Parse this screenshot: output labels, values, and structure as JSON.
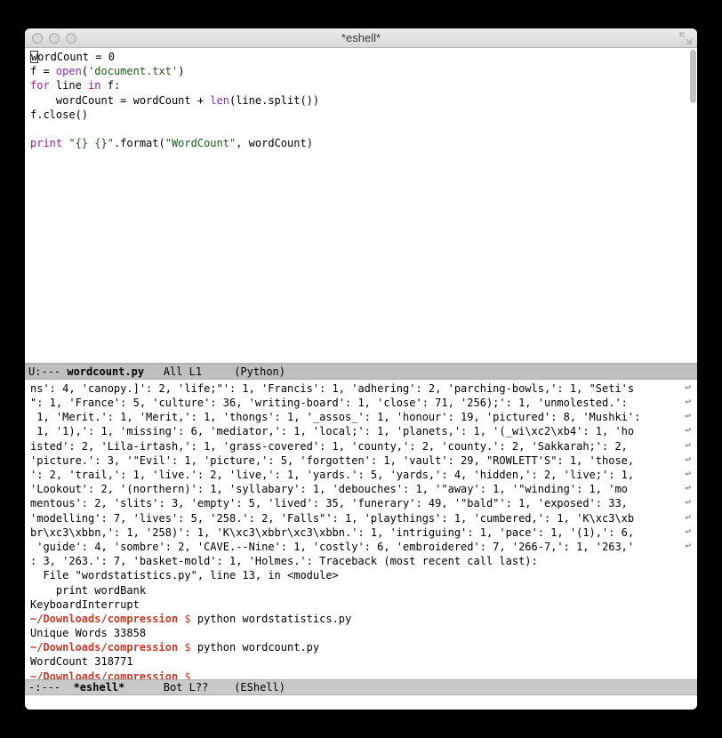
{
  "window": {
    "title": "*eshell*"
  },
  "code": {
    "line1a": "w",
    "line1b": "ordCount = ",
    "line1c": "0",
    "line2a": "f = ",
    "line2b": "open",
    "line2c": "(",
    "line2d": "'document.txt'",
    "line2e": ")",
    "line3a": "for",
    "line3b": " line ",
    "line3c": "in",
    "line3d": " f:",
    "line4a": "    wordCount = wordCount + ",
    "line4b": "len",
    "line4c": "(line.split())",
    "line5": "f.close()",
    "line6": "",
    "line7a": "print",
    "line7b": " ",
    "line7c": "\"{} {}\"",
    "line7d": ".format(",
    "line7e": "\"WordCount\"",
    "line7f": ", wordCount)"
  },
  "modeline_top": {
    "left": "U:--- ",
    "file": "wordcount.py",
    "rest": "   All L1     (Python)"
  },
  "term": {
    "dump": [
      "ns': 4, 'canopy.]': 2, 'life;\"': 1, 'Francis': 1, 'adhering': 2, 'parching-bowls,': 1, \"Seti's",
      "\": 1, 'France': 5, 'culture': 36, 'writing-board': 1, 'close': 71, '256);': 1, 'unmolested.':",
      " 1, 'Merit.': 1, 'Merit,': 1, 'thongs': 1, '_assos_': 1, 'honour': 19, 'pictured': 8, 'Mushki':",
      " 1, '1),': 1, 'missing': 6, 'mediator,': 1, 'local;': 1, 'planets,': 1, '(_wi\\xc2\\xb4': 1, 'ho",
      "isted': 2, 'Lila-irtash,': 1, 'grass-covered': 1, 'county,': 2, 'county.': 2, 'Sakkarah;': 2, ",
      "'picture.': 3, '\"Evil': 1, 'picture,': 5, 'forgotten': 1, 'vault': 29, \"ROWLETT'S\": 1, 'those,",
      "': 2, 'trail,': 1, 'live.': 2, 'live,': 1, 'yards.': 5, 'yards,': 4, 'hidden,': 2, 'live;': 1, ",
      "'Lookout': 2, '(northern)': 1, 'syllabary': 1, 'debouches': 1, '\"away': 1, '\"winding': 1, 'mo",
      "mentous': 2, 'slits': 3, 'empty': 5, 'lived': 35, 'funerary': 49, '\"bald\"': 1, 'exposed': 33, ",
      "'modelling': 7, 'lives': 5, '258.': 2, 'Falls\"': 1, 'playthings': 1, 'cumbered,': 1, 'K\\xc3\\xb",
      "br\\xc3\\xbbn,': 1, '258)': 1, 'K\\xc3\\xbbr\\xc3\\xbbn.': 1, 'intriguing': 1, 'pace': 1, '(1),': 6,",
      " 'guide': 4, 'sombre': 2, 'CAVE.--Nine': 1, 'costly': 6, 'embroidered': 7, '266-7,': 1, '263,'",
      ": 3, '263.': 7, 'basket-mold': 1, 'Holmes.': Traceback (most recent call last):"
    ],
    "trace1": "  File \"wordstatistics.py\", line 13, in <module>",
    "trace2": "    print wordBank",
    "trace3": "KeyboardInterrupt",
    "prompt_path": "~/Downloads/compression",
    "dollar": " $ ",
    "cmd1": "python wordstatistics.py",
    "out1": "Unique Words 33858",
    "cmd2": "python wordcount.py",
    "out2": "WordCount 318771"
  },
  "modeline_bot": {
    "left": "-:---  ",
    "file": "*eshell*",
    "rest": "      Bot L??    (EShell)"
  }
}
